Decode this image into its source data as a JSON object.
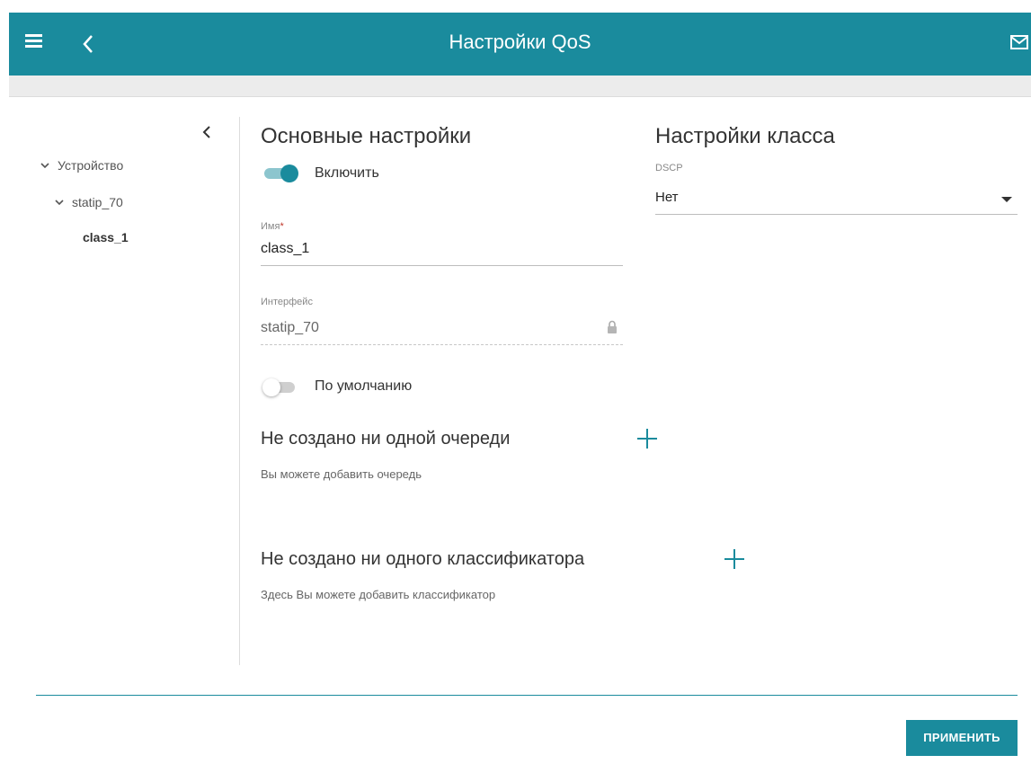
{
  "header": {
    "title": "Настройки QoS",
    "accent_color": "#1a8b9d"
  },
  "icons": {
    "menu": "hamburger-menu-icon",
    "back": "chevron-left-icon",
    "mail": "envelope-icon",
    "collapse": "chevron-left-icon",
    "lock": "lock-icon",
    "add": "plus-icon"
  },
  "tree": {
    "items": [
      {
        "label": "Устройство",
        "expanded": true
      },
      {
        "label": "statip_70",
        "expanded": true
      },
      {
        "label": "class_1",
        "selected": true
      }
    ]
  },
  "basic": {
    "heading": "Основные настройки",
    "enable_label": "Включить",
    "enable_on": true,
    "name_label": "Имя",
    "name_required_mark": "*",
    "name_value": "class_1",
    "interface_label": "Интерфейс",
    "interface_value": "statip_70",
    "default_label": "По умолчанию",
    "default_on": false
  },
  "queues": {
    "title": "Не создано ни одной очереди",
    "hint": "Вы можете добавить очередь"
  },
  "classifiers": {
    "title": "Не создано ни одного классификатора",
    "hint": "Здесь Вы можете добавить классификатор"
  },
  "class_settings": {
    "heading": "Настройки класса",
    "dscp_label": "DSCP",
    "dscp_value": "Нет"
  },
  "footer": {
    "apply_label": "ПРИМЕНИТЬ"
  }
}
